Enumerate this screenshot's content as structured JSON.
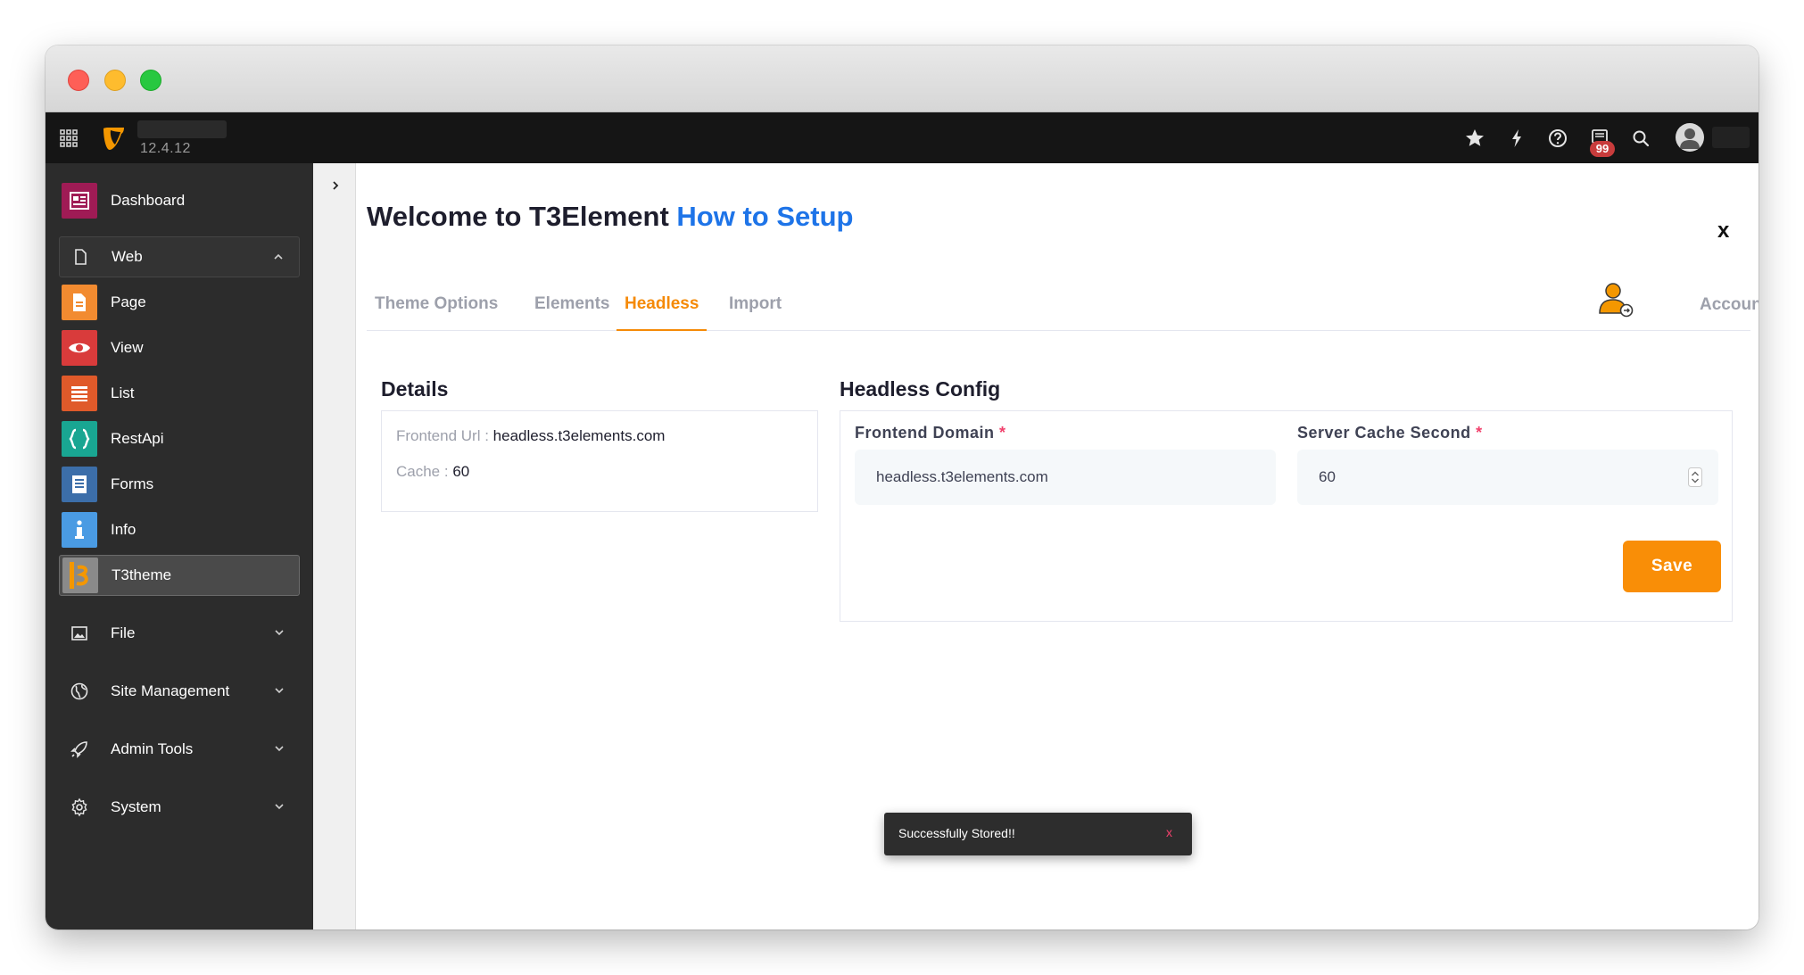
{
  "topbar": {
    "version": "12.4.12",
    "notification_count": "99",
    "icons": [
      "apps-grid-icon",
      "typo3-logo-icon",
      "star-icon",
      "bolt-icon",
      "help-icon",
      "notifications-icon",
      "search-icon",
      "user-icon"
    ]
  },
  "sidebar": {
    "dashboard": "Dashboard",
    "web": "Web",
    "page": "Page",
    "view": "View",
    "list": "List",
    "restapi": "RestApi",
    "forms": "Forms",
    "info": "Info",
    "t3theme": "T3theme",
    "file": "File",
    "site_management": "Site Management",
    "admin_tools": "Admin Tools",
    "system": "System"
  },
  "main": {
    "title": "Welcome to T3Element",
    "title_link": "How to Setup",
    "close": "x",
    "tabs": [
      {
        "label": "Theme Options"
      },
      {
        "label": "Elements"
      },
      {
        "label": "Headless"
      },
      {
        "label": "Import"
      }
    ],
    "active_tab": "Headless",
    "account_label": "Account"
  },
  "details": {
    "title": "Details",
    "frontend_url_label": "Frontend Url :",
    "frontend_url_value": "headless.t3elements.com",
    "cache_label": "Cache :",
    "cache_value": "60"
  },
  "config": {
    "title": "Headless Config",
    "frontend_domain_label": "Frontend Domain",
    "frontend_domain_value": "headless.t3elements.com",
    "server_cache_label": "Server Cache Second",
    "server_cache_value": "60",
    "required_marker": "*",
    "save_label": "Save"
  },
  "toast": {
    "message": "Successfully Stored!!",
    "close": "x"
  },
  "colors": {
    "accent": "#f58a07",
    "link": "#1e74e8",
    "sidebar_bg": "#2c2c2c",
    "topbar_bg": "#151515"
  }
}
